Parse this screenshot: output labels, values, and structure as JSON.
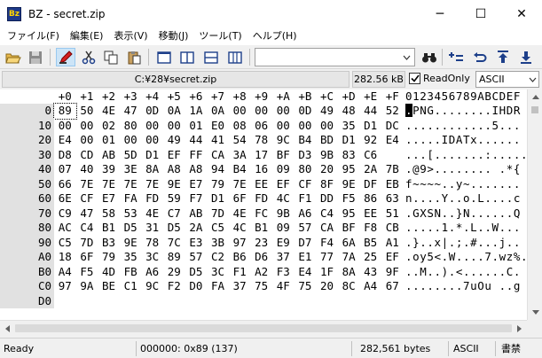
{
  "window": {
    "title": "BZ - secret.zip",
    "app_icon_text": "Bz",
    "minimize": "─",
    "maximize": "☐",
    "close": "✕"
  },
  "menu": [
    "ファイル(F)",
    "編集(E)",
    "表示(V)",
    "移動(J)",
    "ツール(T)",
    "ヘルプ(H)"
  ],
  "toolbar": {
    "search_value": "",
    "icons": [
      "open-folder",
      "save",
      "toggle-edit",
      "cut",
      "copy",
      "paste",
      "view-single",
      "view-split-vertical",
      "view-split-horizontal",
      "view-compare",
      "binoculars-find",
      "add-jump",
      "back-jump",
      "up-jump",
      "down-jump"
    ]
  },
  "info": {
    "path": "C:¥28¥secret.zip",
    "size": "282.56 kB",
    "readonly_label": "ReadOnly",
    "readonly_checked": true,
    "encoding": "ASCII"
  },
  "hex": {
    "header_cols": [
      "+0",
      "+1",
      "+2",
      "+3",
      "+4",
      "+5",
      "+6",
      "+7",
      "+8",
      "+9",
      "+A",
      "+B",
      "+C",
      "+D",
      "+E",
      "+F"
    ],
    "header_ascii": "0123456789ABCDEF",
    "rows": [
      {
        "offset": "0",
        "bytes": [
          "89",
          "50",
          "4E",
          "47",
          "0D",
          "0A",
          "1A",
          "0A",
          "00",
          "00",
          "00",
          "0D",
          "49",
          "48",
          "44",
          "52"
        ],
        "ascii": ".PNG........IHDR"
      },
      {
        "offset": "10",
        "bytes": [
          "00",
          "00",
          "02",
          "80",
          "00",
          "00",
          "01",
          "E0",
          "08",
          "06",
          "00",
          "00",
          "00",
          "35",
          "D1",
          "DC"
        ],
        "ascii": "............5..."
      },
      {
        "offset": "20",
        "bytes": [
          "E4",
          "00",
          "01",
          "00",
          "00",
          "49",
          "44",
          "41",
          "54",
          "78",
          "9C",
          "B4",
          "BD",
          "D1",
          "92",
          "E4"
        ],
        "ascii": ".....IDATx......"
      },
      {
        "offset": "30",
        "bytes": [
          "D8",
          "CD",
          "AB",
          "5D",
          "D1",
          "EF",
          "FF",
          "CA",
          "3A",
          "17",
          "BF",
          "D3",
          "9B",
          "83",
          "C6"
        ],
        "ascii": "...[.......:....."
      },
      {
        "offset": "40",
        "bytes": [
          "07",
          "40",
          "39",
          "3E",
          "8A",
          "A8",
          "A8",
          "94",
          "B4",
          "16",
          "09",
          "80",
          "20",
          "95",
          "2A",
          "7B"
        ],
        "ascii": ".@9>........ .*{"
      },
      {
        "offset": "50",
        "bytes": [
          "66",
          "7E",
          "7E",
          "7E",
          "7E",
          "9E",
          "E7",
          "79",
          "7E",
          "EE",
          "EF",
          "CF",
          "8F",
          "9E",
          "DF",
          "EB"
        ],
        "ascii": "f~~~~..y~......."
      },
      {
        "offset": "60",
        "bytes": [
          "6E",
          "CF",
          "E7",
          "FA",
          "FD",
          "59",
          "F7",
          "D1",
          "6F",
          "FD",
          "4C",
          "F1",
          "DD",
          "F5",
          "86",
          "63"
        ],
        "ascii": "n....Y..o.L....c"
      },
      {
        "offset": "70",
        "bytes": [
          "C9",
          "47",
          "58",
          "53",
          "4E",
          "C7",
          "AB",
          "7D",
          "4E",
          "FC",
          "9B",
          "A6",
          "C4",
          "95",
          "EE",
          "51"
        ],
        "ascii": ".GXSN..}N......Q"
      },
      {
        "offset": "80",
        "bytes": [
          "AC",
          "C4",
          "B1",
          "D5",
          "31",
          "D5",
          "2A",
          "C5",
          "4C",
          "B1",
          "09",
          "57",
          "CA",
          "BF",
          "F8",
          "CB"
        ],
        "ascii": ".....1.*.L..W..."
      },
      {
        "offset": "90",
        "bytes": [
          "C5",
          "7D",
          "B3",
          "9E",
          "78",
          "7C",
          "E3",
          "3B",
          "97",
          "23",
          "E9",
          "D7",
          "F4",
          "6A",
          "B5",
          "A1"
        ],
        "ascii": ".}..x|.;.#...j.."
      },
      {
        "offset": "A0",
        "bytes": [
          "18",
          "6F",
          "79",
          "35",
          "3C",
          "89",
          "57",
          "C2",
          "B6",
          "D6",
          "37",
          "E1",
          "77",
          "7A",
          "25",
          "EF"
        ],
        "ascii": ".oy5<.W....7.wz%."
      },
      {
        "offset": "B0",
        "bytes": [
          "A4",
          "F5",
          "4D",
          "FB",
          "A6",
          "29",
          "D5",
          "3C",
          "F1",
          "A2",
          "F3",
          "E4",
          "1F",
          "8A",
          "43",
          "9F"
        ],
        "ascii": "..M..).<......C."
      },
      {
        "offset": "C0",
        "bytes": [
          "97",
          "9A",
          "BE",
          "C1",
          "9C",
          "F2",
          "D0",
          "FA",
          "37",
          "75",
          "4F",
          "75",
          "20",
          "8C",
          "A4",
          "67"
        ],
        "ascii": "........7uOu ..g"
      },
      {
        "offset": "D0",
        "bytes": [
          "",
          "",
          "",
          "",
          "",
          "",
          "",
          "",
          "",
          "",
          "",
          "",
          "",
          "",
          "",
          ""
        ],
        "ascii": ""
      }
    ]
  },
  "status": {
    "state": "Ready",
    "position": "000000: 0x89 (137)",
    "filesize": "282,561 bytes",
    "encoding": "ASCII",
    "mode": "書禁"
  }
}
